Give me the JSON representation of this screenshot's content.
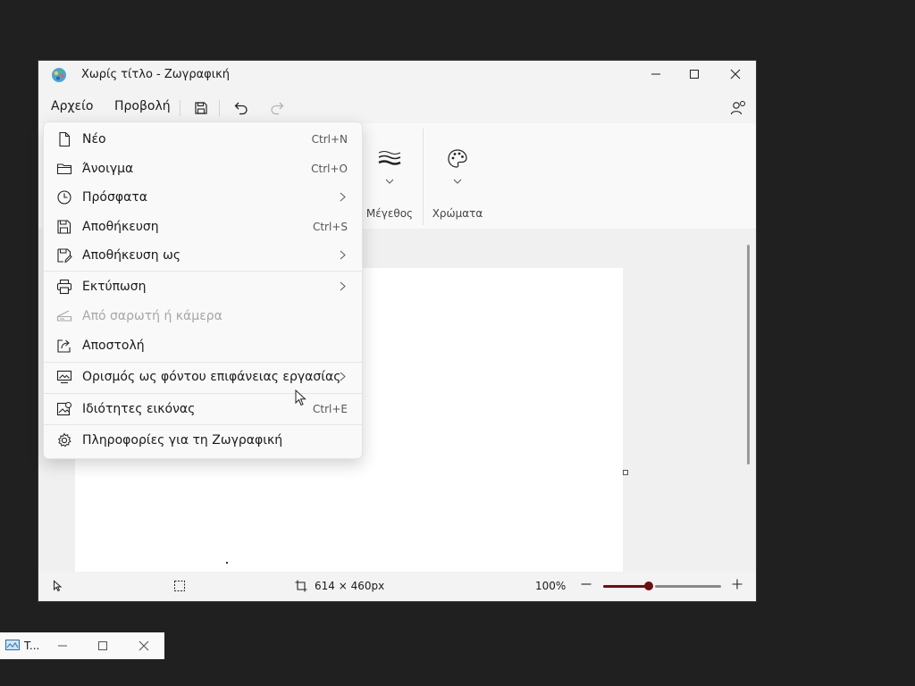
{
  "window": {
    "title": "Χωρίς τίτλο - Ζωγραφική"
  },
  "menubar": {
    "tabs": [
      "Αρχείο",
      "Προβολή"
    ]
  },
  "ribbon": {
    "size_label": "Μέγεθος",
    "colors_label": "Χρώματα"
  },
  "file_menu": {
    "items": [
      {
        "label": "Νέο",
        "shortcut": "Ctrl+N",
        "icon": "new-file-icon"
      },
      {
        "label": "Άνοιγμα",
        "shortcut": "Ctrl+O",
        "icon": "folder-icon"
      },
      {
        "label": "Πρόσφατα",
        "submenu": true,
        "icon": "clock-icon"
      },
      {
        "label": "Αποθήκευση",
        "shortcut": "Ctrl+S",
        "icon": "save-icon"
      },
      {
        "label": "Αποθήκευση ως",
        "submenu": true,
        "icon": "save-as-icon"
      },
      {
        "label": "Εκτύπωση",
        "submenu": true,
        "icon": "printer-icon"
      },
      {
        "label": "Από σαρωτή ή κάμερα",
        "disabled": true,
        "icon": "scanner-icon"
      },
      {
        "label": "Αποστολή",
        "icon": "share-icon"
      },
      {
        "label": "Ορισμός ως φόντου επιφάνειας εργασίας",
        "submenu": true,
        "icon": "desktop-background-icon"
      },
      {
        "label": "Ιδιότητες εικόνας",
        "shortcut": "Ctrl+E",
        "icon": "image-properties-icon"
      },
      {
        "label": "Πληροφορίες για τη Ζωγραφική",
        "icon": "gear-icon"
      }
    ]
  },
  "statusbar": {
    "canvas_size": "614 × 460px",
    "zoom": "100%",
    "zoom_fraction": 0.38
  },
  "taskbar_window": {
    "title": "T..."
  },
  "colors": {
    "accent": "#6b0f0f",
    "background": "#202020"
  }
}
